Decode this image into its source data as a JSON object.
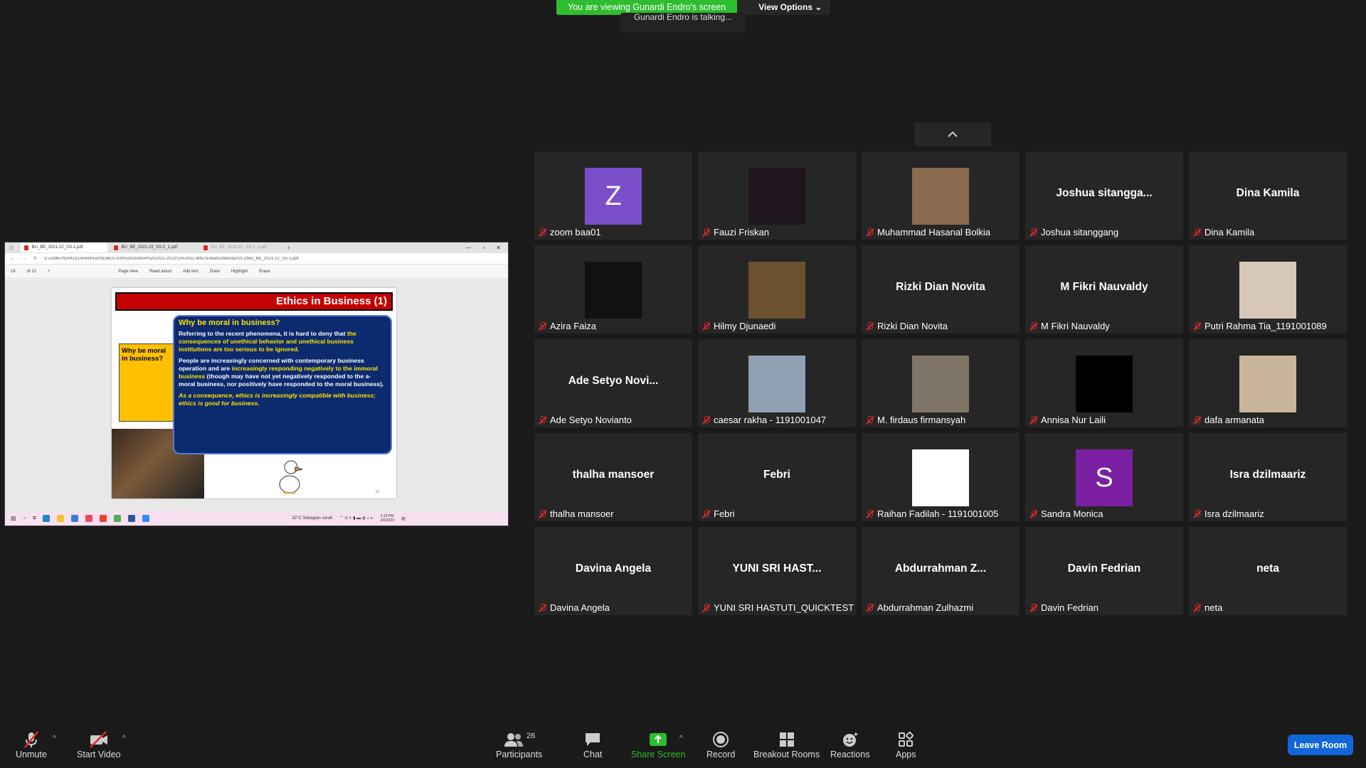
{
  "banner": {
    "viewing": "You are viewing Gunardi Endro's screen",
    "view_options": "View Options",
    "talking": "Gunardi Endro is talking..."
  },
  "shared_screen": {
    "tabs": [
      "BU_BE_2021-22_SS-1.pdf",
      "BU_BE_2021-22_SS-2_1.pdf",
      "BU_BE_2021-22_SS-2_2.pdf"
    ],
    "url": "D:/Z99B-PERKULIAHAN%20SEMESTER%20GENAP%202021-2022/1)%20S1-MNJ-Etika%20Bisnis/SS-1/BU_BE_2021-22_SS-1.pdf",
    "page_current": "18",
    "page_total": "of 22",
    "pdf_tools": [
      "Page view",
      "Read aloud",
      "Add text",
      "Draw",
      "Highlight",
      "Erase"
    ],
    "slide": {
      "title": "Ethics in Business (1)",
      "side_box": "Why be moral in business?",
      "bubble_heading": "Why be moral in business?",
      "p1_a": "Referring to the recent phenomena, it is hard to deny that ",
      "p1_b": "the consequences of unethical behavior and unethical business institutions are too serious to be ignored.",
      "p2_a": "People are increasingly concerned with contemporary business operation and are ",
      "p2_b": "increasingly responding negatively to the immoral business",
      "p2_c": " (though may have not yet negatively responded to the a-moral business, nor positively have responded to the moral business).",
      "p3": "As a consequence, ethics is increasingly compatible with business; ethics is good for business.",
      "page_no": "18"
    },
    "taskbar": {
      "weather": "32°C  Sebagian cerah",
      "time": "2:19 PM",
      "date": "3/2/2022"
    }
  },
  "participants": [
    {
      "name": "zoom baa01",
      "display": "",
      "avatar_letter": "Z",
      "avatar_color": "#7a4fc9",
      "kind": "letter"
    },
    {
      "name": "Fauzi Friskan",
      "display": "",
      "kind": "photo",
      "avatar_color": "#1e161c"
    },
    {
      "name": "Muhammad Hasanal Bolkia",
      "display": "",
      "kind": "photo",
      "avatar_color": "#8a6b50"
    },
    {
      "name": "Joshua sitanggang",
      "display": "Joshua  sitangga...",
      "kind": "text"
    },
    {
      "name": "Dina Kamila",
      "display": "Dina Kamila",
      "kind": "text"
    },
    {
      "name": "Azira Faiza",
      "display": "",
      "kind": "photo",
      "avatar_color": "#111111"
    },
    {
      "name": "Hilmy Djunaedi",
      "display": "",
      "kind": "photo",
      "avatar_color": "#6b5130"
    },
    {
      "name": "Rizki Dian Novita",
      "display": "Rizki Dian Novita",
      "kind": "text"
    },
    {
      "name": "M Fikri Nauvaldy",
      "display": "M Fikri Nauvaldy",
      "kind": "text"
    },
    {
      "name": "Putri Rahma Tia_1191001089",
      "display": "",
      "kind": "photo",
      "avatar_color": "#d7c8b8"
    },
    {
      "name": "Ade Setyo Novianto",
      "display": "Ade Setyo Novi...",
      "kind": "text"
    },
    {
      "name": "caesar rakha - 1191001047",
      "display": "",
      "kind": "photo",
      "avatar_color": "#8fa1b3"
    },
    {
      "name": "M. firdaus firmansyah",
      "display": "",
      "kind": "photo",
      "avatar_color": "#7e7566"
    },
    {
      "name": "Annisa Nur Laili",
      "display": "",
      "kind": "photo",
      "avatar_color": "#000000"
    },
    {
      "name": "dafa armanata",
      "display": "",
      "kind": "photo",
      "avatar_color": "#c9b59a"
    },
    {
      "name": "thalha mansoer",
      "display": "thalha mansoer",
      "kind": "text"
    },
    {
      "name": "Febri",
      "display": "Febri",
      "kind": "text"
    },
    {
      "name": "Raihan Fadilah - 1191001005",
      "display": "",
      "kind": "photo",
      "avatar_color": "#ffffff"
    },
    {
      "name": "Sandra Monica",
      "display": "",
      "avatar_letter": "S",
      "avatar_color": "#7b1fa2",
      "kind": "letter"
    },
    {
      "name": "Isra dzilmaariz",
      "display": "Isra dzilmaariz",
      "kind": "text"
    },
    {
      "name": "Davina Angela",
      "display": "Davina Angela",
      "kind": "text"
    },
    {
      "name": "YUNI SRI HASTUTI_QUICKTEST",
      "display": "YUNI  SRI  HAST...",
      "kind": "text"
    },
    {
      "name": "Abdurrahman Zulhazmi",
      "display": "Abdurrahman  Z...",
      "kind": "text"
    },
    {
      "name": "Davin Fedrian",
      "display": "Davin Fedrian",
      "kind": "text"
    },
    {
      "name": "neta",
      "display": "neta",
      "kind": "text"
    }
  ],
  "toolbar": {
    "unmute": "Unmute",
    "start_video": "Start Video",
    "participants": "Participants",
    "participants_count": "26",
    "chat": "Chat",
    "share_screen": "Share Screen",
    "record": "Record",
    "breakout_rooms": "Breakout Rooms",
    "reactions": "Reactions",
    "apps": "Apps",
    "leave": "Leave Room"
  }
}
